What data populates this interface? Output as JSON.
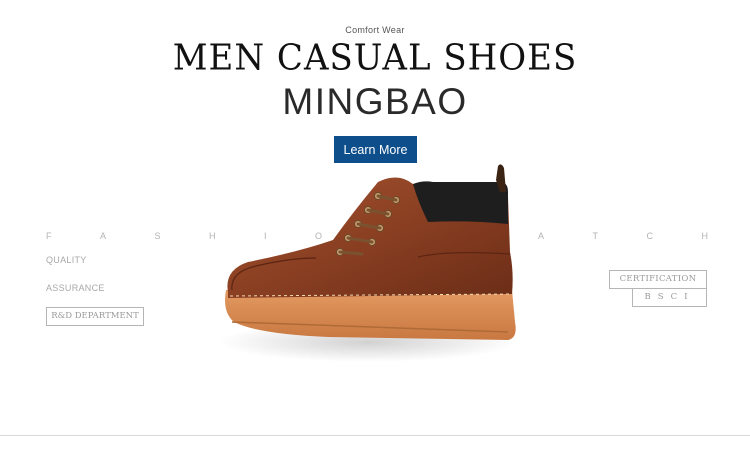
{
  "hero": {
    "eyebrow": "Comfort Wear",
    "title": "MEN CASUAL SHOES",
    "brand": "MINGBAO",
    "cta_label": "Learn More"
  },
  "left_panel": {
    "spaced_letters": [
      "F",
      "A",
      "S",
      "H",
      "I",
      "O"
    ],
    "labels": [
      "QUALITY",
      "ASSURANCE"
    ],
    "box_label": "R&D DEPARTMENT"
  },
  "right_panel": {
    "spaced_letters": [
      "A",
      "T",
      "C",
      "H"
    ],
    "cert_label": "CERTIFICATION",
    "bsci_label": "BSCI"
  },
  "colors": {
    "cta_background": "#0e4f8b",
    "boot_leather": "#8a3f22",
    "sole": "#d98a52",
    "collar": "#1e1e1e"
  },
  "icons": {
    "product": "brown-leather-boot"
  }
}
